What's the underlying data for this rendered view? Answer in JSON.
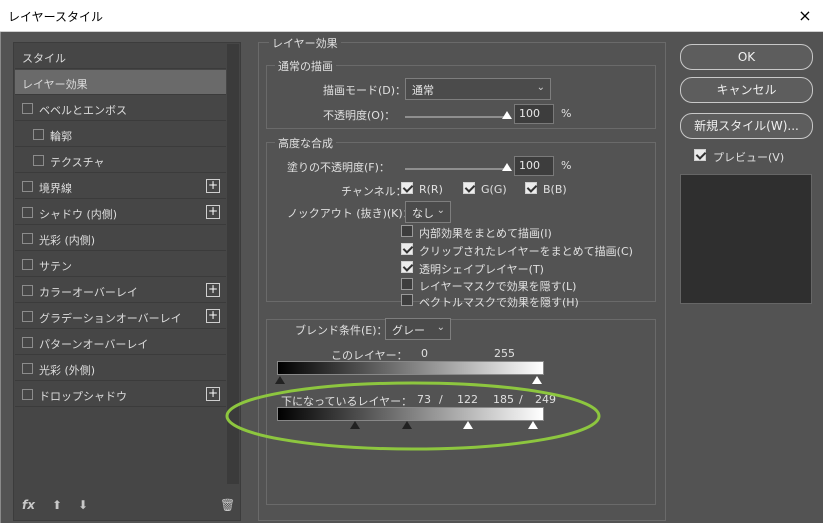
{
  "window": {
    "title": "レイヤースタイル",
    "close_icon": "×"
  },
  "left_panel": {
    "items": [
      {
        "label": "スタイル",
        "checkbox": false,
        "plus": false,
        "indent": false,
        "selected": false
      },
      {
        "label": "レイヤー効果",
        "checkbox": false,
        "plus": false,
        "indent": false,
        "selected": true
      },
      {
        "label": "ベベルとエンボス",
        "checkbox": true,
        "plus": false,
        "indent": false,
        "selected": false
      },
      {
        "label": "輪郭",
        "checkbox": true,
        "plus": false,
        "indent": true,
        "selected": false
      },
      {
        "label": "テクスチャ",
        "checkbox": true,
        "plus": false,
        "indent": true,
        "selected": false
      },
      {
        "label": "境界線",
        "checkbox": true,
        "plus": true,
        "indent": false,
        "selected": false
      },
      {
        "label": "シャドウ (内側)",
        "checkbox": true,
        "plus": true,
        "indent": false,
        "selected": false
      },
      {
        "label": "光彩 (内側)",
        "checkbox": true,
        "plus": false,
        "indent": false,
        "selected": false
      },
      {
        "label": "サテン",
        "checkbox": true,
        "plus": false,
        "indent": false,
        "selected": false
      },
      {
        "label": "カラーオーバーレイ",
        "checkbox": true,
        "plus": true,
        "indent": false,
        "selected": false
      },
      {
        "label": "グラデーションオーバーレイ",
        "checkbox": true,
        "plus": true,
        "indent": false,
        "selected": false
      },
      {
        "label": "パターンオーバーレイ",
        "checkbox": true,
        "plus": false,
        "indent": false,
        "selected": false
      },
      {
        "label": "光彩 (外側)",
        "checkbox": true,
        "plus": false,
        "indent": false,
        "selected": false
      },
      {
        "label": "ドロップシャドウ",
        "checkbox": true,
        "plus": true,
        "indent": false,
        "selected": false
      }
    ],
    "plus_glyph": "+",
    "tools": {
      "fx": "fx",
      "up": "⬆",
      "down": "⬇",
      "trash": "🗑"
    }
  },
  "main": {
    "title": "レイヤー効果",
    "normal": {
      "title": "通常の描画",
      "blend_mode_label": "描画モード(D)：",
      "blend_mode_value": "通常",
      "opacity_label": "不透明度(O)：",
      "opacity_value": "100",
      "opacity_unit": "%"
    },
    "advanced": {
      "title": "高度な合成",
      "fill_label": "塗りの不透明度(F)：",
      "fill_value": "100",
      "fill_unit": "%",
      "channel_label": "チャンネル：",
      "channels": [
        "R(R)",
        "G(G)",
        "B(B)"
      ],
      "knockout_label": "ノックアウト (抜き)(K)：",
      "knockout_value": "なし",
      "options": [
        {
          "label": "内部効果をまとめて描画(I)",
          "checked": false
        },
        {
          "label": "クリップされたレイヤーをまとめて描画(C)",
          "checked": true
        },
        {
          "label": "透明シェイプレイヤー(T)",
          "checked": true
        },
        {
          "label": "レイヤーマスクで効果を隠す(L)",
          "checked": false
        },
        {
          "label": "ベクトルマスクで効果を隠す(H)",
          "checked": false
        }
      ]
    },
    "blend_if": {
      "label": "ブレンド条件(E)：",
      "value": "グレー",
      "this_layer_label": "このレイヤー：",
      "this_layer_values": [
        "0",
        "255"
      ],
      "underlying_label": "下になっているレイヤー：",
      "underlying_values": [
        "73",
        "/",
        "122",
        "185",
        "/",
        "249"
      ]
    }
  },
  "right": {
    "ok": "OK",
    "cancel": "キャンセル",
    "new_style": "新規スタイル(W)...",
    "preview_label": "プレビュー(V)"
  },
  "colors": {
    "panel": "#535353",
    "highlight_ellipse": "#8dc63f"
  }
}
